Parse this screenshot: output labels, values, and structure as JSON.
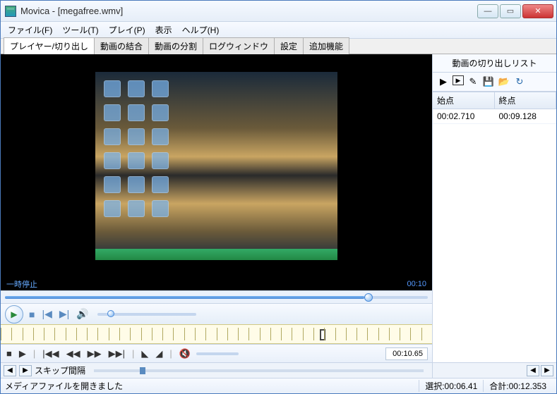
{
  "title": "Movica - [megafree.wmv]",
  "menu": {
    "file": "ファイル(F)",
    "tools": "ツール(T)",
    "play": "プレイ(P)",
    "view": "表示",
    "help": "ヘルプ(H)"
  },
  "tabs": {
    "player": "プレイヤー/切り出し",
    "join": "動画の結合",
    "split": "動画の分割",
    "log": "ログウィンドウ",
    "settings": "設定",
    "extra": "追加機能"
  },
  "player": {
    "status": "一時停止",
    "time_disp": "00:10",
    "edit_time": "00:10.65"
  },
  "skip_label": "スキップ間隔",
  "right": {
    "title": "動画の切り出しリスト",
    "col_start": "始点",
    "col_end": "終点",
    "rows": [
      {
        "start": "00:02.710",
        "end": "00:09.128"
      }
    ]
  },
  "status": {
    "message": "メディアファイルを開きました",
    "selection_label": "選択:",
    "selection_value": "00:06.41",
    "total_label": "合計:",
    "total_value": "00:12.353"
  }
}
